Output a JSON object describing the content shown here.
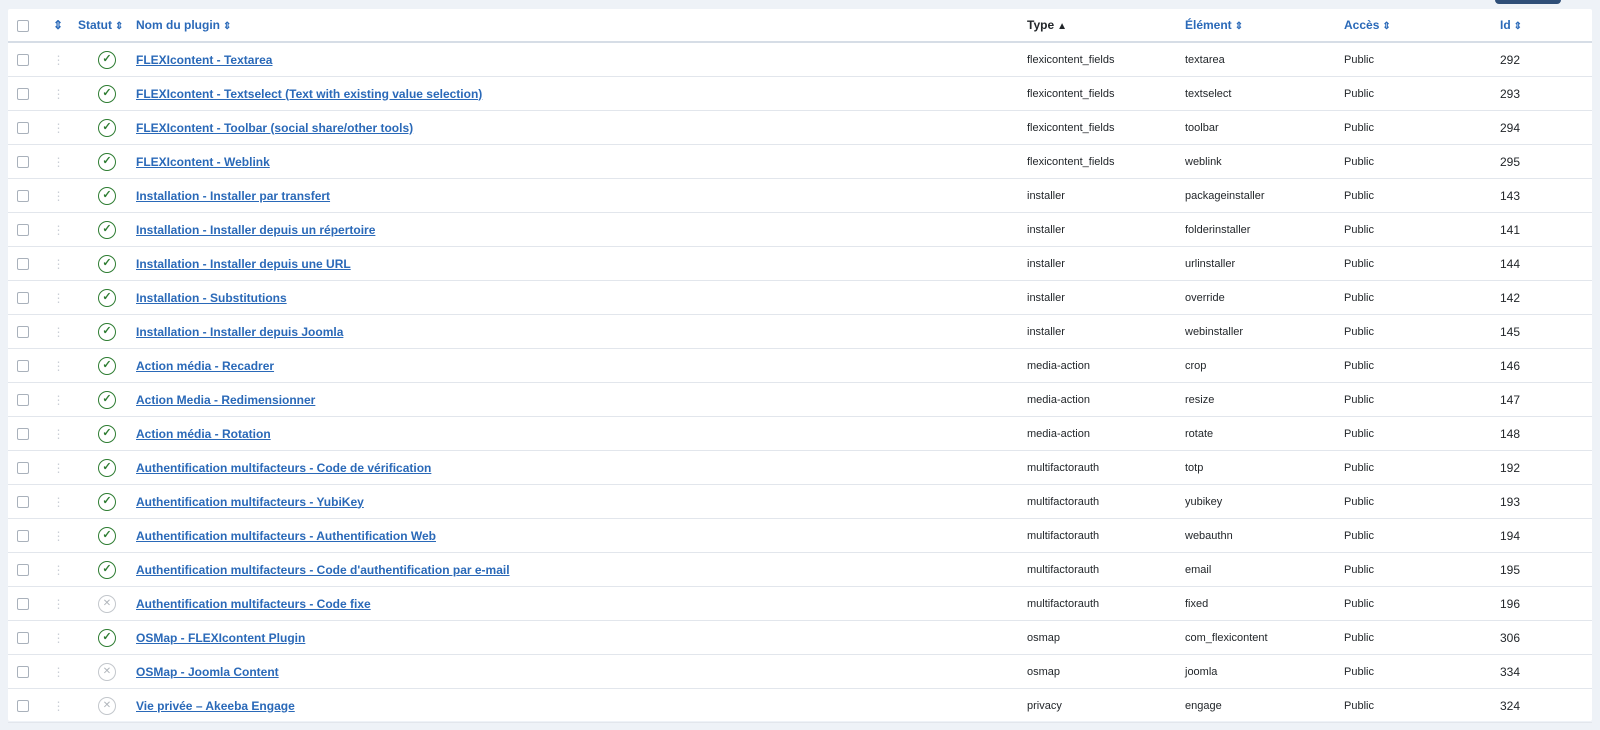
{
  "header": {
    "status": "Statut",
    "name": "Nom du plugin",
    "type": "Type",
    "element": "Élément",
    "access": "Accès",
    "id": "Id",
    "sort_both_icon": "⇕",
    "sort_up_icon": "▲"
  },
  "rows": [
    {
      "name": "FLEXIcontent - Textarea",
      "type": "flexicontent_fields",
      "element": "textarea",
      "access": "Public",
      "id": "292",
      "enabled": true
    },
    {
      "name": "FLEXIcontent - Textselect (Text with existing value selection)",
      "type": "flexicontent_fields",
      "element": "textselect",
      "access": "Public",
      "id": "293",
      "enabled": true
    },
    {
      "name": "FLEXIcontent - Toolbar (social share/other tools)",
      "type": "flexicontent_fields",
      "element": "toolbar",
      "access": "Public",
      "id": "294",
      "enabled": true
    },
    {
      "name": "FLEXIcontent - Weblink",
      "type": "flexicontent_fields",
      "element": "weblink",
      "access": "Public",
      "id": "295",
      "enabled": true
    },
    {
      "name": "Installation - Installer par transfert",
      "type": "installer",
      "element": "packageinstaller",
      "access": "Public",
      "id": "143",
      "enabled": true
    },
    {
      "name": "Installation - Installer depuis un répertoire",
      "type": "installer",
      "element": "folderinstaller",
      "access": "Public",
      "id": "141",
      "enabled": true
    },
    {
      "name": "Installation - Installer depuis une URL",
      "type": "installer",
      "element": "urlinstaller",
      "access": "Public",
      "id": "144",
      "enabled": true
    },
    {
      "name": "Installation - Substitutions",
      "type": "installer",
      "element": "override",
      "access": "Public",
      "id": "142",
      "enabled": true
    },
    {
      "name": "Installation - Installer depuis Joomla",
      "type": "installer",
      "element": "webinstaller",
      "access": "Public",
      "id": "145",
      "enabled": true
    },
    {
      "name": "Action média - Recadrer",
      "type": "media-action",
      "element": "crop",
      "access": "Public",
      "id": "146",
      "enabled": true
    },
    {
      "name": "Action Media - Redimensionner",
      "type": "media-action",
      "element": "resize",
      "access": "Public",
      "id": "147",
      "enabled": true
    },
    {
      "name": "Action média - Rotation",
      "type": "media-action",
      "element": "rotate",
      "access": "Public",
      "id": "148",
      "enabled": true
    },
    {
      "name": "Authentification multifacteurs - Code de vérification",
      "type": "multifactorauth",
      "element": "totp",
      "access": "Public",
      "id": "192",
      "enabled": true
    },
    {
      "name": "Authentification multifacteurs - YubiKey",
      "type": "multifactorauth",
      "element": "yubikey",
      "access": "Public",
      "id": "193",
      "enabled": true
    },
    {
      "name": "Authentification multifacteurs - Authentification Web",
      "type": "multifactorauth",
      "element": "webauthn",
      "access": "Public",
      "id": "194",
      "enabled": true
    },
    {
      "name": "Authentification multifacteurs - Code d'authentification par e-mail",
      "type": "multifactorauth",
      "element": "email",
      "access": "Public",
      "id": "195",
      "enabled": true
    },
    {
      "name": "Authentification multifacteurs - Code fixe",
      "type": "multifactorauth",
      "element": "fixed",
      "access": "Public",
      "id": "196",
      "enabled": false
    },
    {
      "name": "OSMap - FLEXIcontent Plugin",
      "type": "osmap",
      "element": "com_flexicontent",
      "access": "Public",
      "id": "306",
      "enabled": true
    },
    {
      "name": "OSMap - Joomla Content",
      "type": "osmap",
      "element": "joomla",
      "access": "Public",
      "id": "334",
      "enabled": false
    },
    {
      "name": "Vie privée – Akeeba Engage",
      "type": "privacy",
      "element": "engage",
      "access": "Public",
      "id": "324",
      "enabled": false
    }
  ],
  "colors": {
    "link": "#2a69b8",
    "enabled": "#2e7d32",
    "disabled": "#b0b5bb"
  },
  "icons": {
    "enabled": "check-circle-icon",
    "disabled": "x-circle-icon",
    "drag": "drag-handle-icon"
  }
}
